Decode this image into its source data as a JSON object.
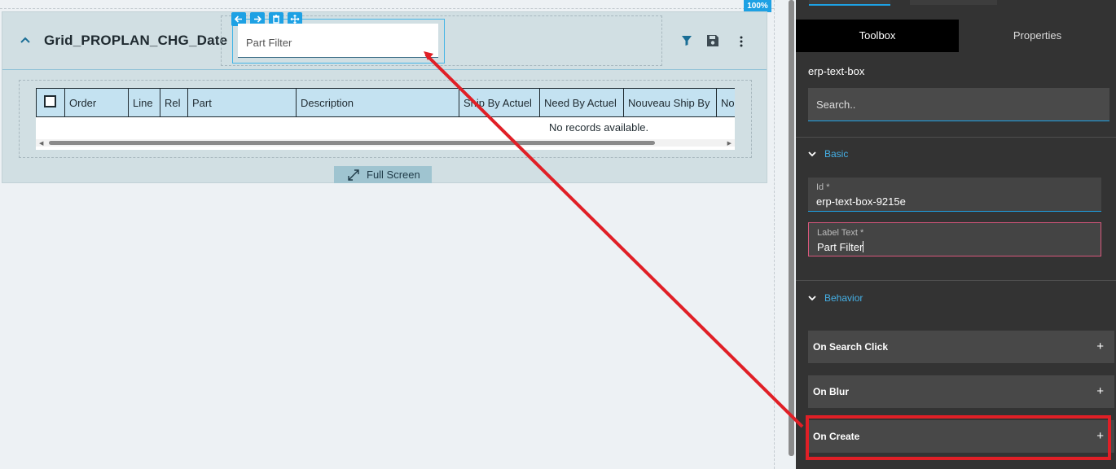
{
  "canvas": {
    "zoom": "100%",
    "panel": {
      "title": "Grid_PROPLAN_CHG_Date",
      "filter": {
        "placeholder": "Part Filter"
      },
      "grid": {
        "columns": [
          "Order",
          "Line",
          "Rel",
          "Part",
          "Description",
          "Ship By Actuel",
          "Need By Actuel",
          "Nouveau Ship By",
          "No"
        ],
        "empty_message": "No records available."
      },
      "fullscreen_label": "Full Screen"
    }
  },
  "sidebar": {
    "tabs": [
      {
        "label": "Toolbox",
        "active": true
      },
      {
        "label": "Properties",
        "active": false
      }
    ],
    "component_name": "erp-text-box",
    "search_placeholder": "Search..",
    "sections": {
      "basic": {
        "title": "Basic",
        "fields": [
          {
            "label": "Id *",
            "value": "erp-text-box-9215e"
          },
          {
            "label": "Label Text *",
            "value": "Part Filter"
          }
        ]
      },
      "behavior": {
        "title": "Behavior",
        "events": [
          {
            "label": "On Search Click",
            "action": "+"
          },
          {
            "label": "On Blur",
            "action": "+"
          },
          {
            "label": "On Create",
            "action": "+"
          }
        ]
      }
    }
  },
  "colors": {
    "accent": "#1da1e4",
    "annotation": "#e01f26",
    "panel_bg": "#d1dfe3",
    "grid_header": "#c4e2f1",
    "sidebar_bg": "#333333"
  }
}
